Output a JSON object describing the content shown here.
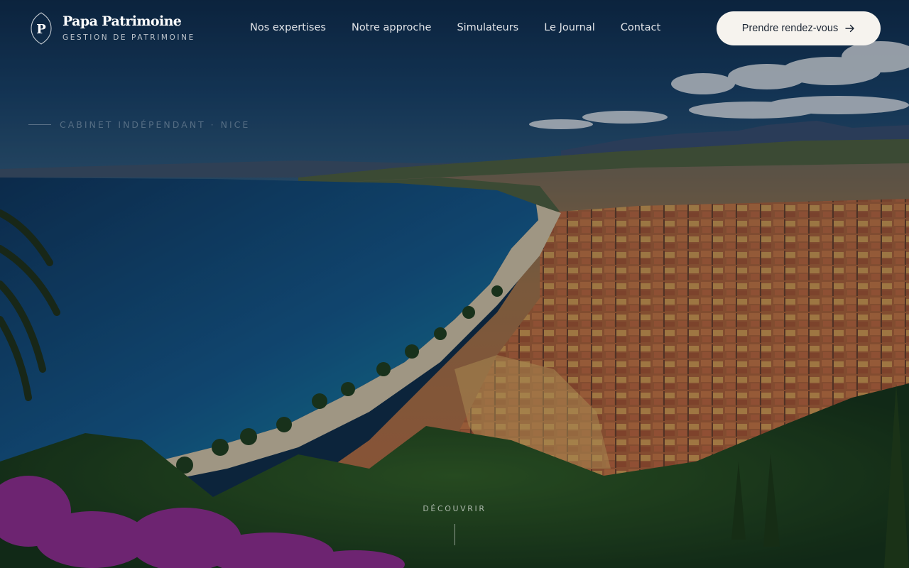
{
  "brand": {
    "initial": "P",
    "name": "Papa Patrimoine",
    "tagline": "GESTION DE PATRIMOINE"
  },
  "nav": {
    "items": [
      {
        "label": "Nos expertises"
      },
      {
        "label": "Notre approche"
      },
      {
        "label": "Simulateurs"
      },
      {
        "label": "Le Journal"
      },
      {
        "label": "Contact"
      }
    ]
  },
  "cta": {
    "label": "Prendre rendez-vous",
    "icon": "arrow-right-icon"
  },
  "hero": {
    "eyebrow": "CABINET INDÉPENDANT · NICE",
    "image": "aerial-view-of-nice-bay",
    "scroll_label": "DÉCOUVRIR"
  },
  "colors": {
    "cta_background": "#f6f3ee",
    "cta_text": "#1b2533",
    "sea": "#1a5a86",
    "roofs": "#c46a3b"
  }
}
